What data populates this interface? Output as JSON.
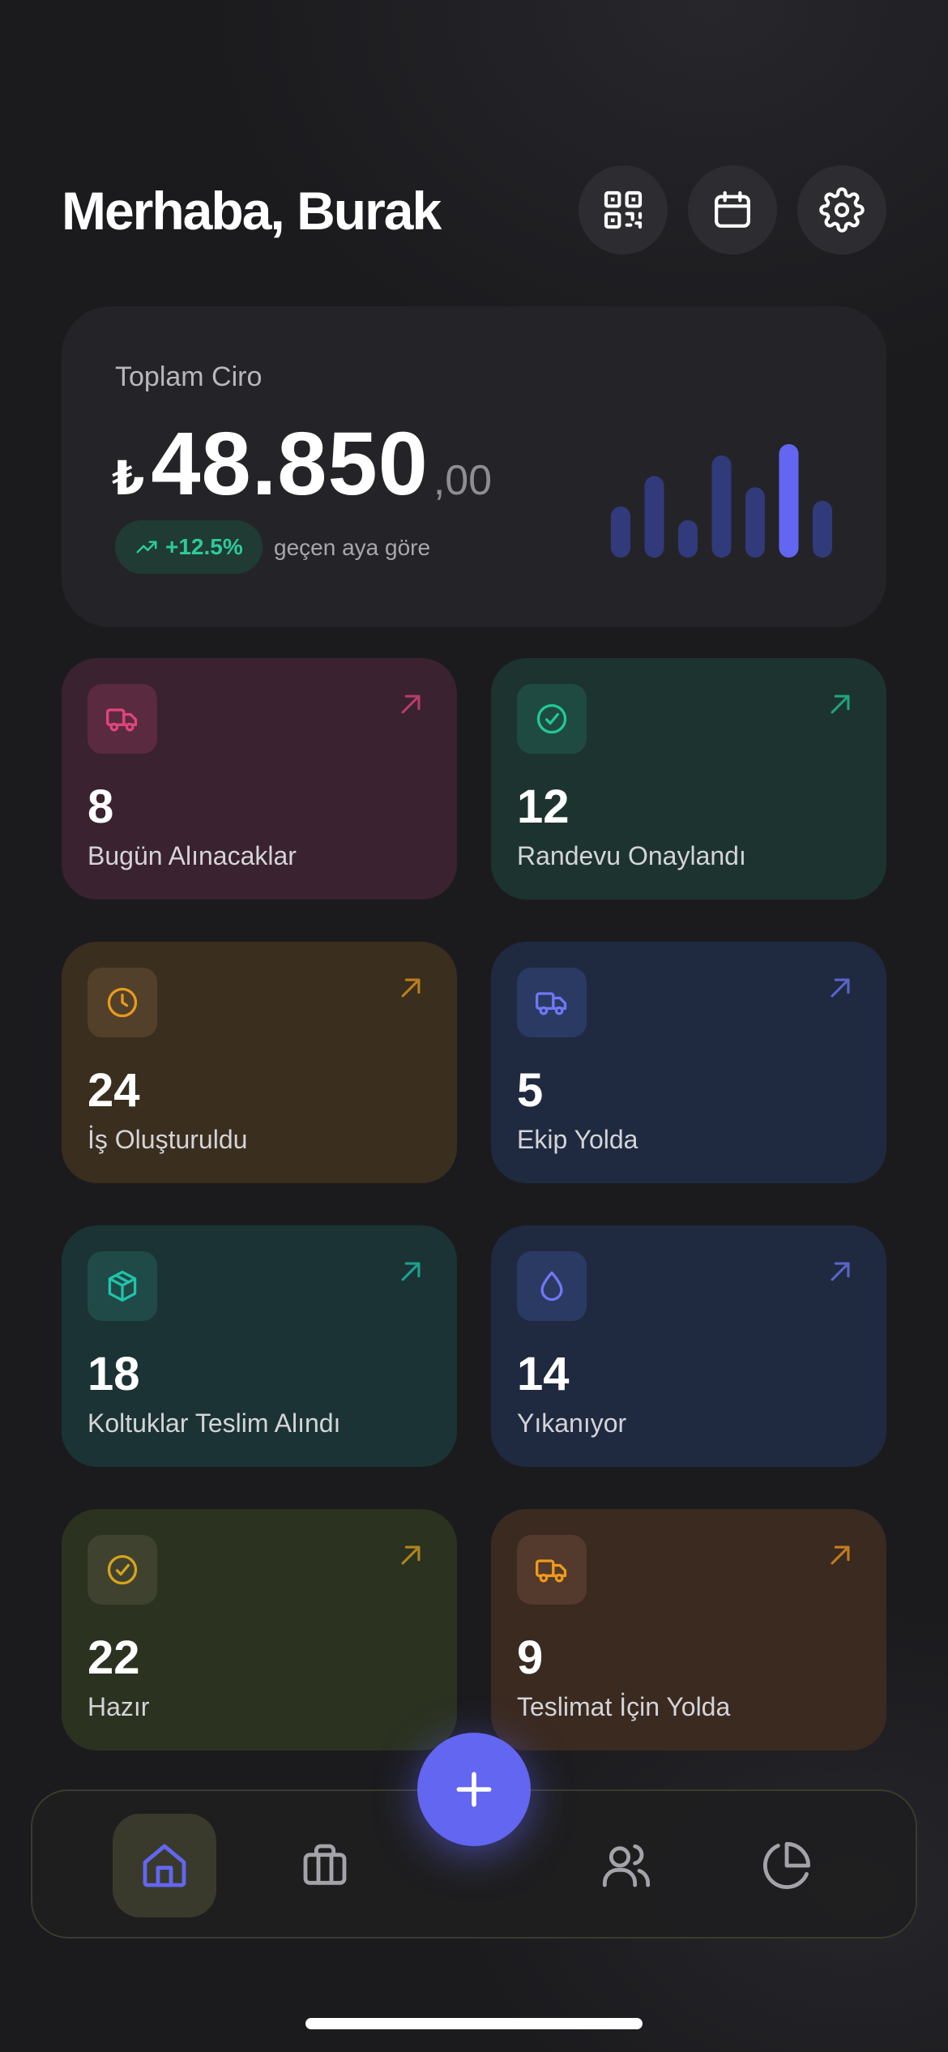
{
  "header": {
    "greeting": "Merhaba, Burak",
    "buttons": [
      {
        "icon": "qr-code-icon"
      },
      {
        "icon": "calendar-icon"
      },
      {
        "icon": "settings-icon"
      }
    ]
  },
  "revenue": {
    "label": "Toplam Ciro",
    "currency": "₺",
    "amount_int": "48.850",
    "amount_dec": ",00",
    "trend": "+12.5%",
    "trend_caption": "geçen aya göre",
    "bar_levels": [
      0.45,
      0.72,
      0.33,
      0.9,
      0.62,
      1.0,
      0.5
    ],
    "highlight_index": 5,
    "bar_color": "#313a7a",
    "highlight_color": "#6366f1"
  },
  "stats": [
    {
      "value": "8",
      "label": "Bugün Alınacaklar",
      "icon": "truck-icon",
      "accent": "#e0457b",
      "bg": "#3a2230",
      "iconbg": "#5a2a40"
    },
    {
      "value": "12",
      "label": "Randevu Onaylandı",
      "icon": "check-circle-icon",
      "accent": "#20c997",
      "bg": "#1d3330",
      "iconbg": "#1f4a42"
    },
    {
      "value": "24",
      "label": "İş Oluşturuldu",
      "icon": "clock-icon",
      "accent": "#e89a1c",
      "bg": "#3a2e1e",
      "iconbg": "#52402a"
    },
    {
      "value": "5",
      "label": "Ekip Yolda",
      "icon": "truck-icon",
      "accent": "#6f78f5",
      "bg": "#1f2a40",
      "iconbg": "#2b3a62"
    },
    {
      "value": "18",
      "label": "Koltuklar Teslim Alındı",
      "icon": "box-icon",
      "accent": "#1fc4aa",
      "bg": "#1b3334",
      "iconbg": "#1f4a48"
    },
    {
      "value": "14",
      "label": "Yıkanıyor",
      "icon": "droplet-icon",
      "accent": "#6f78f5",
      "bg": "#1f2a40",
      "iconbg": "#2b3a62"
    },
    {
      "value": "22",
      "label": "Hazır",
      "icon": "check-circle-icon",
      "accent": "#d8a31c",
      "bg": "#2b3220",
      "iconbg": "#404230"
    },
    {
      "value": "9",
      "label": "Teslimat İçin Yolda",
      "icon": "truck-icon",
      "accent": "#f09a1c",
      "bg": "#3a2a20",
      "iconbg": "#533a2c"
    }
  ],
  "fab": {
    "icon": "plus-icon"
  },
  "tabbar": [
    {
      "icon": "home-icon",
      "active": true
    },
    {
      "icon": "briefcase-icon",
      "active": false
    },
    {
      "icon": "users-icon",
      "active": false
    },
    {
      "icon": "pie-chart-icon",
      "active": false
    }
  ]
}
